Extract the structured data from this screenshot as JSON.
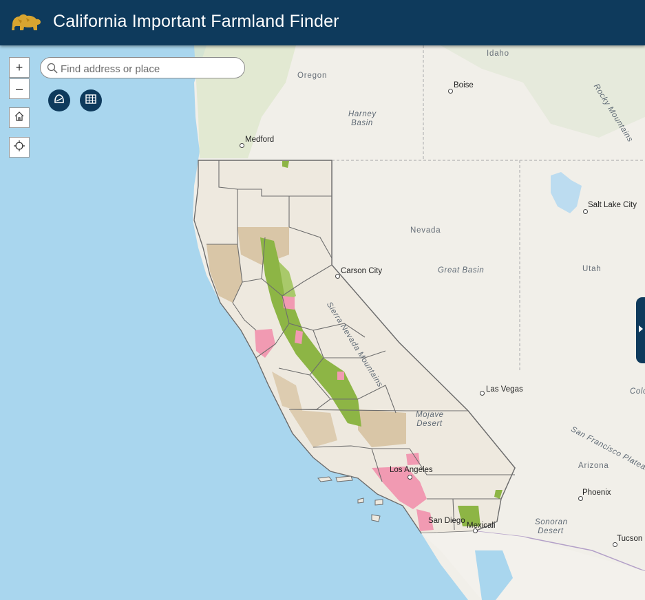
{
  "app": {
    "title": "California Important Farmland Finder"
  },
  "search": {
    "placeholder": "Find address or place"
  },
  "controls": {
    "zoom_in": "+",
    "zoom_out": "–"
  },
  "map_labels": {
    "states": [
      "Idaho",
      "Oregon",
      "Nevada",
      "Utah",
      "Arizona"
    ],
    "regions": [
      "Harney Basin",
      "Great Basin",
      "Mojave Desert",
      "Sonoran Desert",
      "Rocky Mountains",
      "San Francisco Plateau",
      "Sierra Nevada Mountains",
      "Colorado"
    ],
    "cities": [
      "Boise",
      "Medford",
      "Carson City",
      "Salt Lake City",
      "Las Vegas",
      "Los Angeles",
      "Phoenix",
      "Tucson",
      "San Diego",
      "Mexicali"
    ]
  },
  "colors": {
    "header": "#0e3a5c",
    "ocean": "#a9d6ee",
    "land": "#f1efe9",
    "grazing": "#d9c6a7",
    "prime_farmland": "#8db545",
    "urban": "#f19ab2",
    "county_line": "#6d6d6d"
  }
}
